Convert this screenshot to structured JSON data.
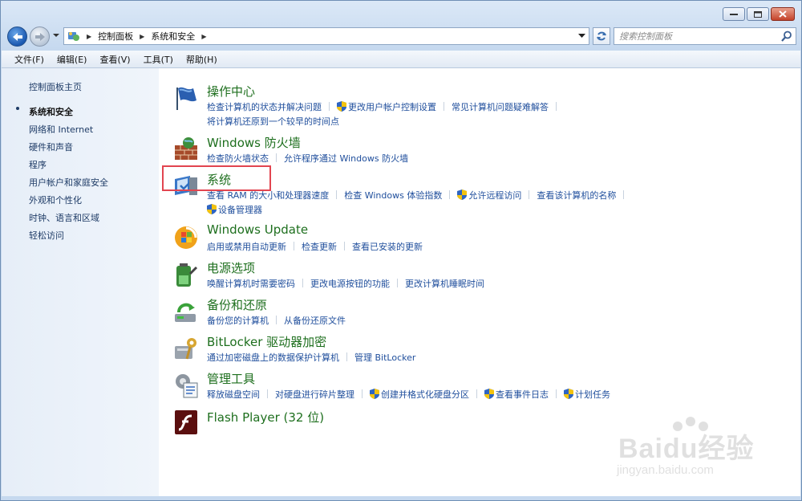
{
  "window": {
    "caption_buttons": [
      "minimize-icon",
      "maximize-icon",
      "close-icon"
    ]
  },
  "address_bar": {
    "segments": [
      "控制面板",
      "系统和安全"
    ],
    "search_placeholder": "搜索控制面板"
  },
  "menu": [
    "文件(F)",
    "编辑(E)",
    "查看(V)",
    "工具(T)",
    "帮助(H)"
  ],
  "left_pane": {
    "home": "控制面板主页",
    "items": [
      "系统和安全",
      "网络和 Internet",
      "硬件和声音",
      "程序",
      "用户帐户和家庭安全",
      "外观和个性化",
      "时钟、语言和区域",
      "轻松访问"
    ],
    "selected": "系统和安全"
  },
  "categories": [
    {
      "title": "操作中心",
      "icon": "flag-icon",
      "links": [
        {
          "text": "检查计算机的状态并解决问题",
          "shield": false
        },
        {
          "text": "更改用户帐户控制设置",
          "shield": true
        },
        {
          "text": "常见计算机问题疑难解答",
          "shield": false
        },
        {
          "text": "将计算机还原到一个较早的时间点",
          "shield": false
        }
      ]
    },
    {
      "title": "Windows 防火墙",
      "icon": "firewall-icon",
      "links": [
        {
          "text": "检查防火墙状态",
          "shield": false
        },
        {
          "text": "允许程序通过 Windows 防火墙",
          "shield": false
        }
      ]
    },
    {
      "title": "系统",
      "icon": "system-icon",
      "links": [
        {
          "text": "查看 RAM 的大小和处理器速度",
          "shield": false
        },
        {
          "text": "检查 Windows 体验指数",
          "shield": false
        },
        {
          "text": "允许远程访问",
          "shield": true
        },
        {
          "text": "查看该计算机的名称",
          "shield": false
        },
        {
          "text": "设备管理器",
          "shield": true
        }
      ]
    },
    {
      "title": "Windows Update",
      "icon": "windows-update-icon",
      "links": [
        {
          "text": "启用或禁用自动更新",
          "shield": false
        },
        {
          "text": "检查更新",
          "shield": false
        },
        {
          "text": "查看已安装的更新",
          "shield": false
        }
      ]
    },
    {
      "title": "电源选项",
      "icon": "power-icon",
      "links": [
        {
          "text": "唤醒计算机时需要密码",
          "shield": false
        },
        {
          "text": "更改电源按钮的功能",
          "shield": false
        },
        {
          "text": "更改计算机睡眠时间",
          "shield": false
        }
      ]
    },
    {
      "title": "备份和还原",
      "icon": "backup-icon",
      "links": [
        {
          "text": "备份您的计算机",
          "shield": false
        },
        {
          "text": "从备份还原文件",
          "shield": false
        }
      ]
    },
    {
      "title": "BitLocker 驱动器加密",
      "icon": "bitlocker-icon",
      "links": [
        {
          "text": "通过加密磁盘上的数据保护计算机",
          "shield": false
        },
        {
          "text": "管理 BitLocker",
          "shield": false
        }
      ]
    },
    {
      "title": "管理工具",
      "icon": "admin-tools-icon",
      "links": [
        {
          "text": "释放磁盘空间",
          "shield": false
        },
        {
          "text": "对硬盘进行碎片整理",
          "shield": false
        },
        {
          "text": "创建并格式化硬盘分区",
          "shield": true
        },
        {
          "text": "查看事件日志",
          "shield": true
        },
        {
          "text": "计划任务",
          "shield": true
        }
      ]
    },
    {
      "title": "Flash Player (32 位)",
      "icon": "flash-player-icon",
      "links": []
    }
  ],
  "highlight_color": "#e24550",
  "watermark": {
    "main": "Baidu经验",
    "sub": "jingyan.baidu.com"
  }
}
